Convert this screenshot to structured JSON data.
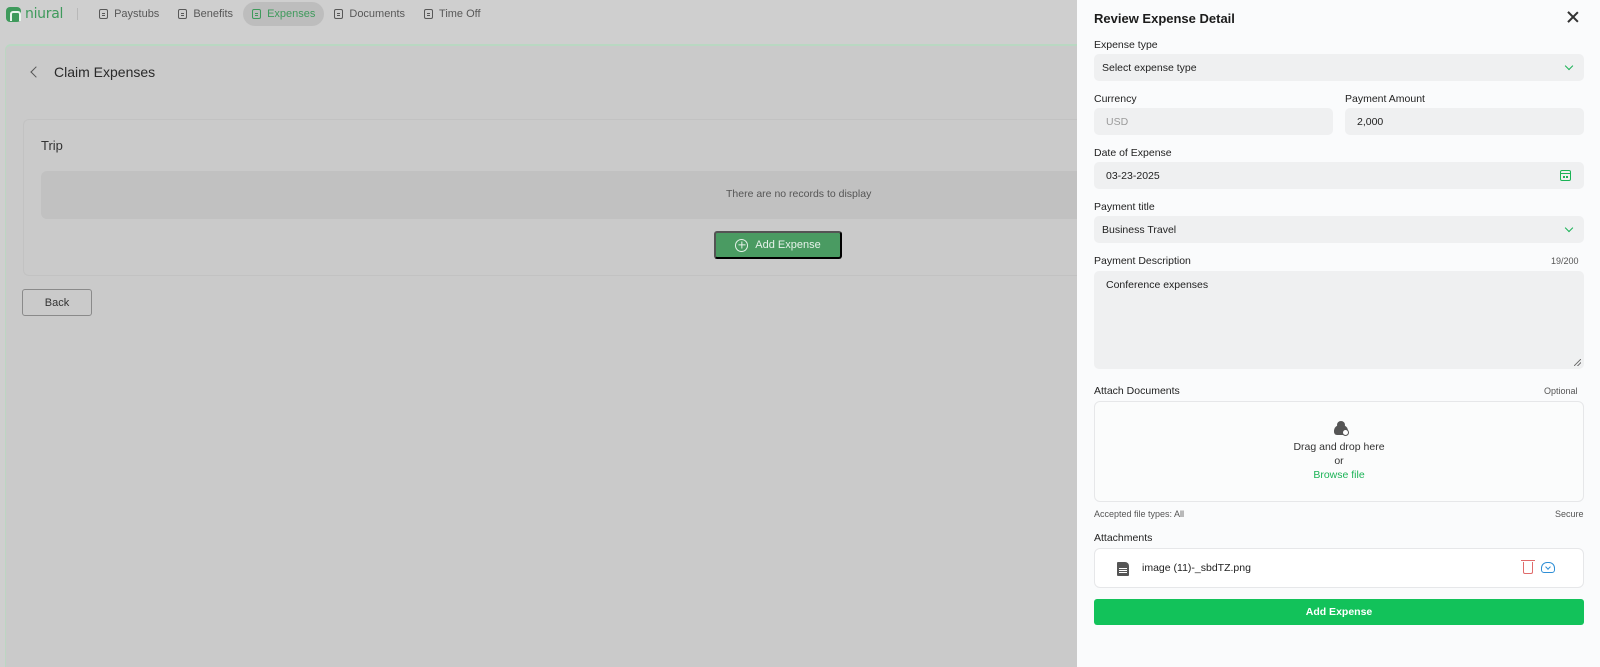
{
  "app": {
    "logo_text": "niural"
  },
  "nav": {
    "items": [
      {
        "label": "Paystubs"
      },
      {
        "label": "Benefits"
      },
      {
        "label": "Expenses"
      },
      {
        "label": "Documents"
      },
      {
        "label": "Time Off"
      }
    ],
    "active_color": "#3f9a5c"
  },
  "page": {
    "title": "Claim Expenses",
    "trip_title": "Trip",
    "empty_message": "There are no records to display",
    "add_expense_label": "Add Expense",
    "back_label": "Back"
  },
  "drawer": {
    "title": "Review Expense Detail",
    "expense_type": {
      "label": "Expense type",
      "value": "Select expense type"
    },
    "currency": {
      "label": "Currency",
      "value": "USD"
    },
    "payment_amount": {
      "label": "Payment Amount",
      "value": "2,000"
    },
    "date": {
      "label": "Date of Expense",
      "value": "03-23-2025"
    },
    "payment_title": {
      "label": "Payment title",
      "value": "Business Travel"
    },
    "description": {
      "label": "Payment Description",
      "counter": "19/200",
      "value": "Conference expenses"
    },
    "attach": {
      "label": "Attach Documents",
      "optional": "Optional",
      "drag_text": "Drag and drop here",
      "or_text": "or",
      "browse_text": "Browse file",
      "accepted": "Accepted file types: All",
      "secure": "Secure"
    },
    "attachments": {
      "label": "Attachments",
      "files": [
        {
          "name": "image (11)-_sbdTZ.png"
        }
      ]
    },
    "submit_label": "Add Expense",
    "accent_color": "#12c25a"
  }
}
